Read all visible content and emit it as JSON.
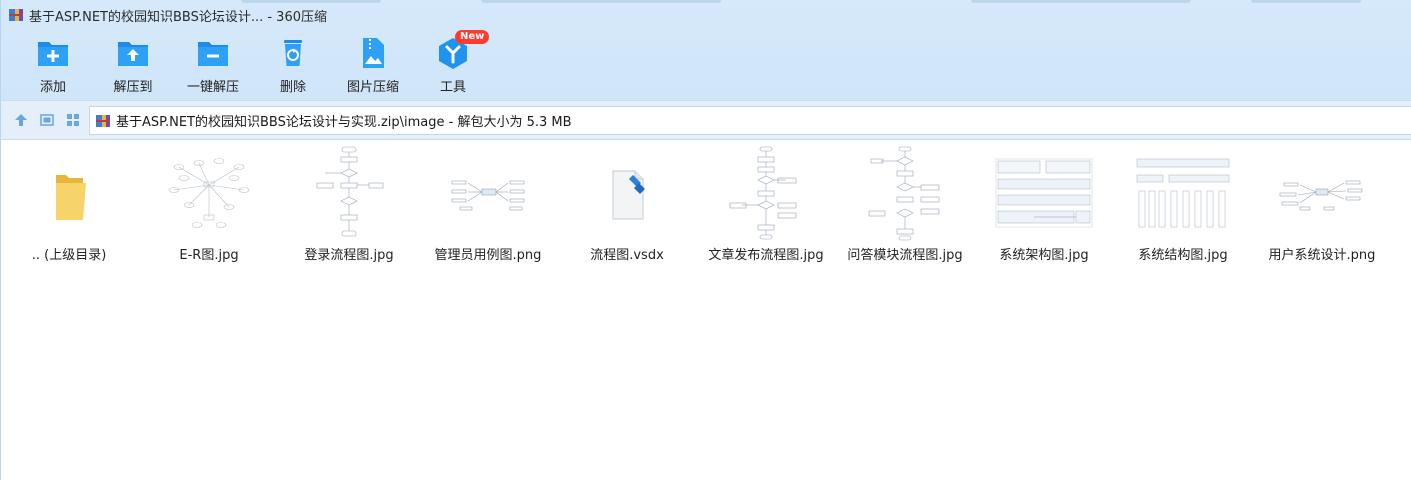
{
  "window": {
    "title": "基于ASP.NET的校园知识BBS论坛设计... - 360压缩"
  },
  "toolbar": {
    "items": [
      {
        "label": "添加",
        "icon": "add-folder-icon"
      },
      {
        "label": "解压到",
        "icon": "extract-to-icon"
      },
      {
        "label": "一键解压",
        "icon": "one-click-extract-icon"
      },
      {
        "label": "删除",
        "icon": "trash-icon"
      },
      {
        "label": "图片压缩",
        "icon": "image-compress-icon"
      },
      {
        "label": "工具",
        "icon": "tools-cube-icon"
      }
    ],
    "new_badge": "New"
  },
  "address": {
    "path": "基于ASP.NET的校园知识BBS论坛设计与实现.zip\\image - 解包大小为 5.3 MB"
  },
  "files": [
    {
      "name": ".. (上级目录)",
      "kind": "folder"
    },
    {
      "name": "E-R图.jpg",
      "kind": "er"
    },
    {
      "name": "登录流程图.jpg",
      "kind": "flow"
    },
    {
      "name": "管理员用例图.png",
      "kind": "usecase"
    },
    {
      "name": "流程图.vsdx",
      "kind": "vsdx"
    },
    {
      "name": "文章发布流程图.jpg",
      "kind": "flow"
    },
    {
      "name": "问答模块流程图.jpg",
      "kind": "flow"
    },
    {
      "name": "系统架构图.jpg",
      "kind": "arch"
    },
    {
      "name": "系统结构图.jpg",
      "kind": "struct"
    },
    {
      "name": "用户系统设计.png",
      "kind": "usecase"
    }
  ],
  "colors": {
    "accent": "#1e8fe6",
    "band": "#d6e9fb",
    "badge": "#ff3b30"
  }
}
